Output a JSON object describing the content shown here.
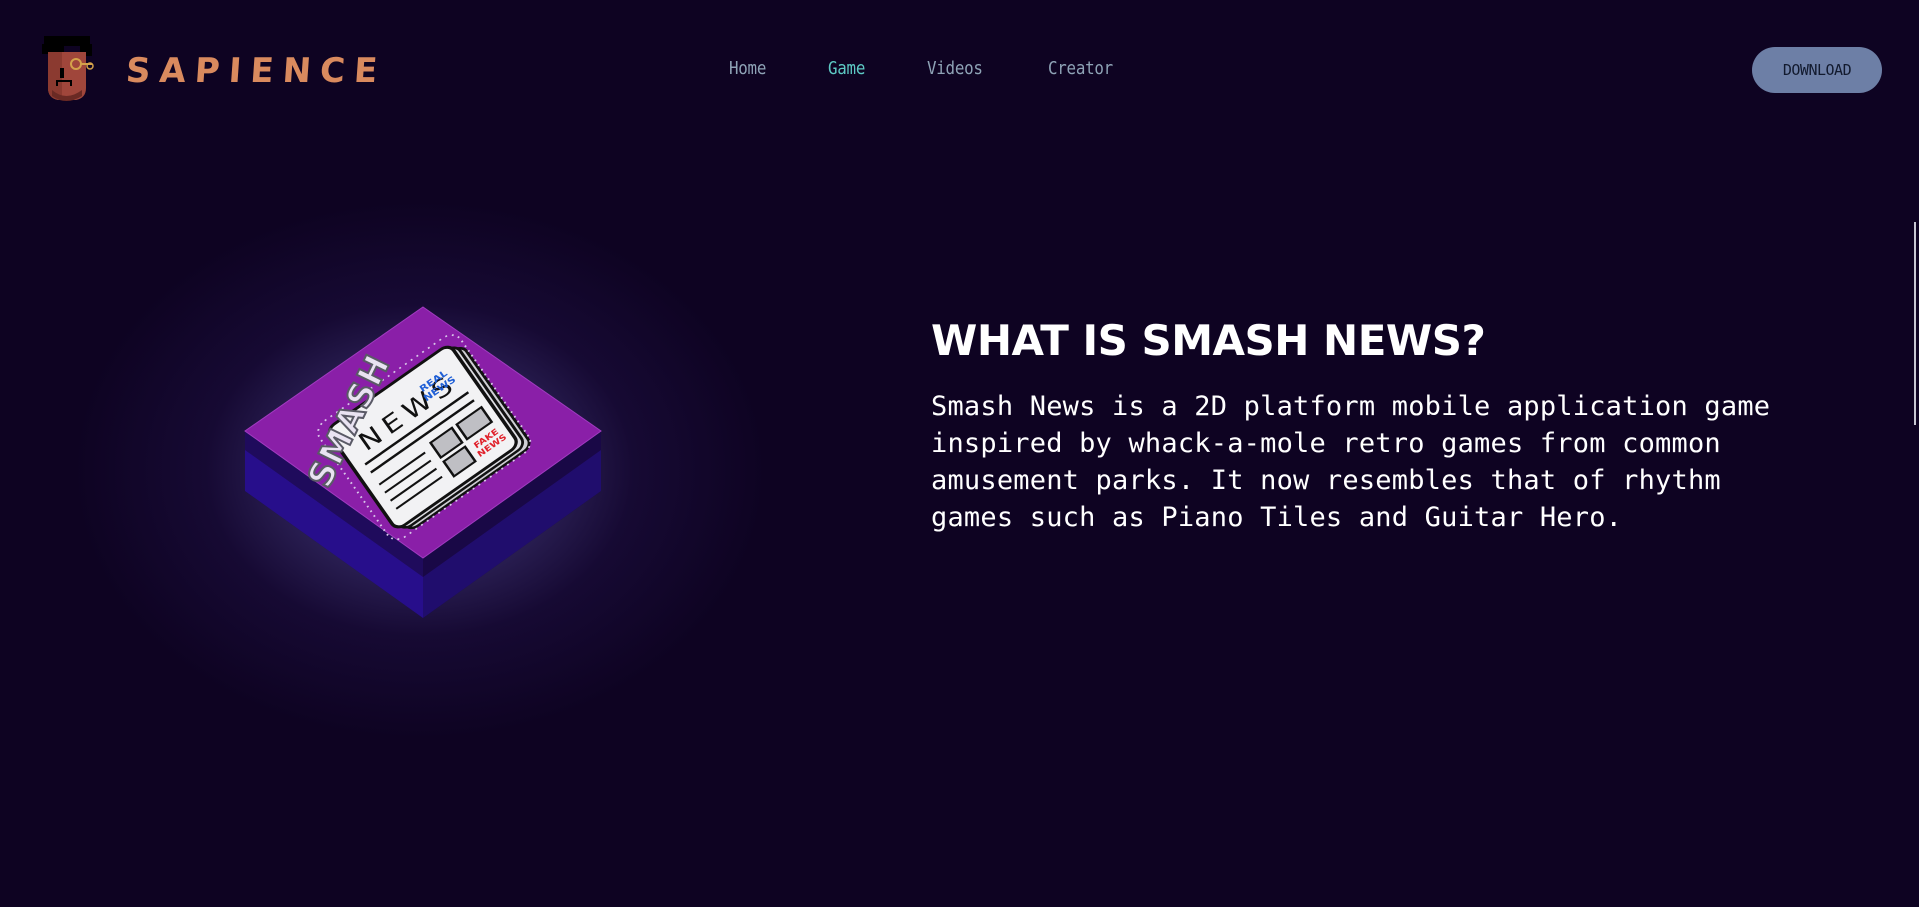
{
  "brand": {
    "name": "SAPIENCE",
    "logo_icon": "character-avatar-icon"
  },
  "nav": {
    "items": [
      {
        "label": "Home",
        "active": false
      },
      {
        "label": "Game",
        "active": true
      },
      {
        "label": "Videos",
        "active": false
      },
      {
        "label": "Creator",
        "active": false
      }
    ]
  },
  "header": {
    "download_label": "DOWNLOAD"
  },
  "hero": {
    "illustration": {
      "icon": "smash-news-newspaper-icon",
      "smash_text": "SMASH",
      "news_text": "NEWS",
      "real_news_text_1": "REAL",
      "real_news_text_2": "NEWS",
      "fake_news_text_1": "FAKE",
      "fake_news_text_2": "NEWS"
    },
    "heading": "WHAT IS SMASH NEWS?",
    "description": "Smash News is a 2D platform mobile application game inspired by whack-a-mole retro games from common amusement parks. It now resembles that of rhythm games such as Piano Tiles and Guitar Hero."
  },
  "colors": {
    "background": "#0e0322",
    "brand": "#d98a5e",
    "nav_text": "#8ea3b6",
    "nav_active": "#5dc9c4",
    "download_bg": "#6d7fa6",
    "tile_top": "#8a1fa8",
    "tile_side": "#2a0f7a",
    "text": "#ffffff"
  }
}
